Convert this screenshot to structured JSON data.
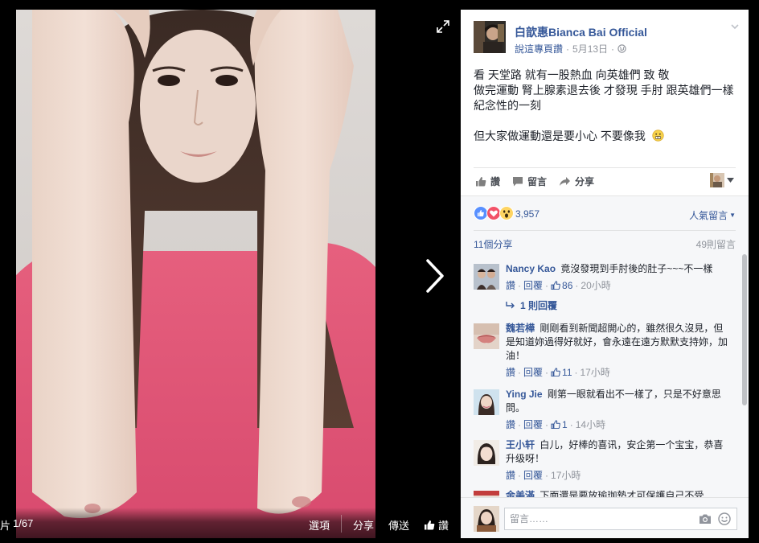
{
  "photo_bar": {
    "counter_prefix": "片",
    "counter": "1/67",
    "options_label": "選項",
    "share_label": "分享",
    "send_label": "傳送",
    "like_label": "讚"
  },
  "post": {
    "page_name": "白歆惠Bianca Bai Official",
    "meta_link": "說這專頁讚",
    "meta_separator": "·",
    "date": "5月13日",
    "meta_separator2": "·",
    "body_lines": [
      "看 天堂路 就有一股熱血 向英雄們 致 敬",
      "做完運動 腎上腺素退去後 才發現 手肘 跟英雄們一樣 紀念性的一刻",
      "",
      "但大家做運動還是要小心 不要像我"
    ],
    "actions": {
      "like": "讚",
      "comment": "留言",
      "share": "分享"
    }
  },
  "feedback": {
    "reaction_count": "3,957",
    "sort_label": "人氣留言",
    "share_count": "11個分享",
    "comment_total": "49則留言"
  },
  "comments": [
    {
      "name": "Nancy Kao",
      "text": "竟沒發現到手肘後的肚子~~~不一樣",
      "like_link": "讚",
      "reply_link": "回覆",
      "likes": "86",
      "time": "20小時",
      "replies": "1 則回覆"
    },
    {
      "name": "魏若樺",
      "text": "剛剛看到新聞超開心的，雖然很久沒見，但是知道妳過得好就好，會永遠在遠方默默支持妳，加油！",
      "like_link": "讚",
      "reply_link": "回覆",
      "likes": "11",
      "time": "17小時"
    },
    {
      "name": "Ying Jie",
      "text": "剛第一眼就看出不一樣了，只是不好意思問。",
      "like_link": "讚",
      "reply_link": "回覆",
      "likes": "1",
      "time": "14小時"
    },
    {
      "name": "王小轩",
      "text": "白儿，好棒的喜讯，安企第一个宝宝，恭喜升级呀！",
      "like_link": "讚",
      "reply_link": "回覆",
      "time": "17小時"
    },
    {
      "name": "金美滿",
      "text": "下面還是要放瑜珈墊才可保護自己不受"
    }
  ],
  "composer": {
    "placeholder": "留言……"
  },
  "icons": {
    "expand": "expand-icon",
    "next": "chevron-right-icon",
    "like": "thumbs-up-icon",
    "comment": "speech-bubble-icon",
    "share": "share-arrow-icon",
    "camera": "camera-icon",
    "sticker": "smiley-icon"
  },
  "colors": {
    "link": "#365899",
    "like_blue": "#5890ff",
    "love_red": "#f25268",
    "haha_yellow": "#fed462"
  }
}
